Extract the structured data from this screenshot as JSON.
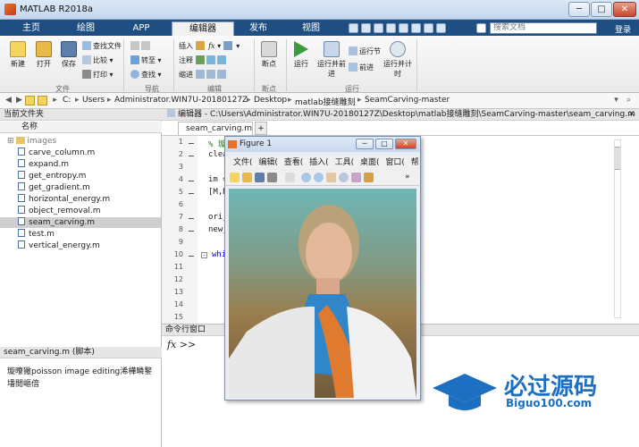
{
  "window": {
    "title": "MATLAB R2018a",
    "min": "─",
    "max": "□",
    "close": "✕"
  },
  "tabs": [
    "主页",
    "绘图",
    "APP",
    "编辑器",
    "发布",
    "视图"
  ],
  "search_placeholder": "搜索文档",
  "login": "登录",
  "ribbon": {
    "file": {
      "new": "新建",
      "open": "打开",
      "save": "保存",
      "find_files": "查找文件",
      "compare": "比较",
      "print": "打印",
      "label": "文件"
    },
    "nav": {
      "goto": "转至",
      "find": "查找",
      "label": "导航"
    },
    "edit": {
      "insert": "插入",
      "fx": "fx",
      "comment": "注释",
      "indent": "缩进",
      "label": "编辑"
    },
    "breakpoints": {
      "breakpoint": "断点",
      "label": "断点"
    },
    "run": {
      "run": "运行",
      "run_advance": "运行并前进",
      "run_section": "运行节",
      "advance": "前进",
      "run_time": "运行并计时",
      "label": "运行"
    }
  },
  "path": [
    "C:",
    "Users",
    "Administrator.WIN7U-20180127Z",
    "Desktop",
    "matlab接缝雕刻",
    "SeamCarving-master"
  ],
  "current_folder": {
    "title": "当前文件夹",
    "col_name": "名称",
    "folder": "images",
    "files": [
      "carve_column.m",
      "expand.m",
      "get_entropy.m",
      "get_gradient.m",
      "horizontal_energy.m",
      "object_removal.m",
      "seam_carving.m",
      "test.m",
      "vertical_energy.m"
    ],
    "selected": "seam_carving.m"
  },
  "details": {
    "title": "seam_carving.m (脚本)",
    "text1": "璇曢獙poisson image editing浠樺疄鐜",
    "text2": "墦閲嶇偣"
  },
  "editor": {
    "header": "编辑器 - C:\\Users\\Administrator.WIN7U-20180127Z\\Desktop\\matlab接缝雕刻\\SeamCarving-master\\seam_carving.m",
    "tab": "seam_carving.m",
    "add_tab": "+",
    "lines": [
      {
        "n": "1",
        "text": "% 璇"
      },
      {
        "n": "2",
        "text": "clea"
      },
      {
        "n": "3",
        "text": ""
      },
      {
        "n": "4",
        "text": "im ="
      },
      {
        "n": "5",
        "text": "[M,N"
      },
      {
        "n": "6",
        "text": ""
      },
      {
        "n": "7",
        "text": "ori_"
      },
      {
        "n": "8",
        "text": "new_"
      },
      {
        "n": "9",
        "text": ""
      },
      {
        "n": "10",
        "text": "whil"
      },
      {
        "n": "11",
        "text": ""
      },
      {
        "n": "12",
        "text": ""
      },
      {
        "n": "13",
        "text": ""
      },
      {
        "n": "14",
        "text": ""
      },
      {
        "n": "15",
        "text": ""
      }
    ]
  },
  "command_window": {
    "title": "命令行窗口",
    "prompt": "fx >>"
  },
  "figure": {
    "title": "Figure 1",
    "menu": [
      "文件(",
      "编辑(",
      "查看(",
      "插入(",
      "工具(",
      "桌面(",
      "窗口(",
      "帮助("
    ]
  },
  "watermark": {
    "text": "必过源码",
    "url": "Biguo100.com"
  },
  "colors": {
    "tabbar": "#1f4f82",
    "accent": "#e8702a"
  }
}
